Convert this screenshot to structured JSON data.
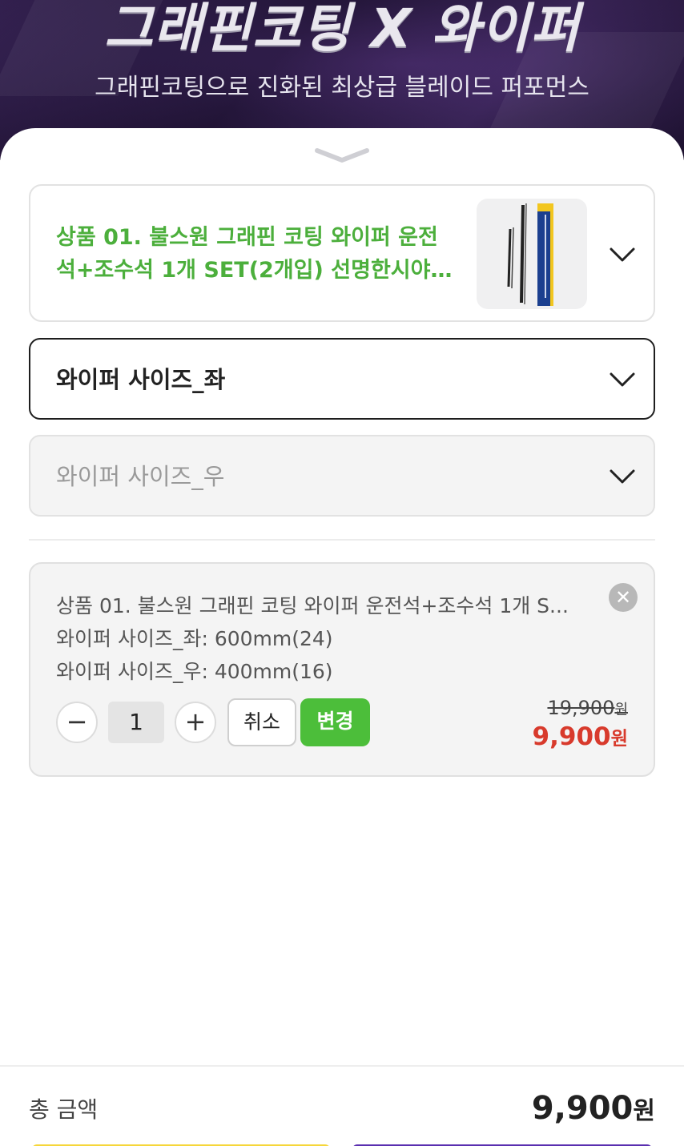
{
  "banner": {
    "title": "그래핀코팅 X 와이퍼",
    "subtitle": "그래핀코팅으로 진화된 최상급 블레이드 퍼포먼스"
  },
  "product_select": {
    "line1": "상품 01. 불스원 그래핀 코팅 와이퍼 운전",
    "line2": "석+조수석 1개 SET(2개입) 선명한시야…",
    "thumbnail_icon": "wiper-product-image"
  },
  "option_left": {
    "label": "와이퍼 사이즈_좌"
  },
  "option_right": {
    "label": "와이퍼 사이즈_우"
  },
  "cart_item": {
    "name": "상품 01. 불스원 그래핀 코팅 와이퍼 운전석+조수석 1개 S...",
    "option_left": "와이퍼 사이즈_좌: 600mm(24)",
    "option_right": "와이퍼 사이즈_우: 400mm(16)",
    "quantity": "1",
    "minus_symbol": "−",
    "plus_symbol": "+",
    "remove_symbol": "✕",
    "cancel_label": "취소",
    "change_label": "변경",
    "original_price": "19,900",
    "sale_price": "9,900",
    "currency": "원"
  },
  "footer": {
    "total_label": "총 금액",
    "total_value": "9,900",
    "currency": "원"
  },
  "colors": {
    "accent_green": "#4cbe3a",
    "product_title_green": "#4caf3c",
    "sale_red": "#d83a2c",
    "banner_purple": "#24163a",
    "button_yellow": "#f6d63a",
    "button_purple": "#5a2fb0"
  }
}
